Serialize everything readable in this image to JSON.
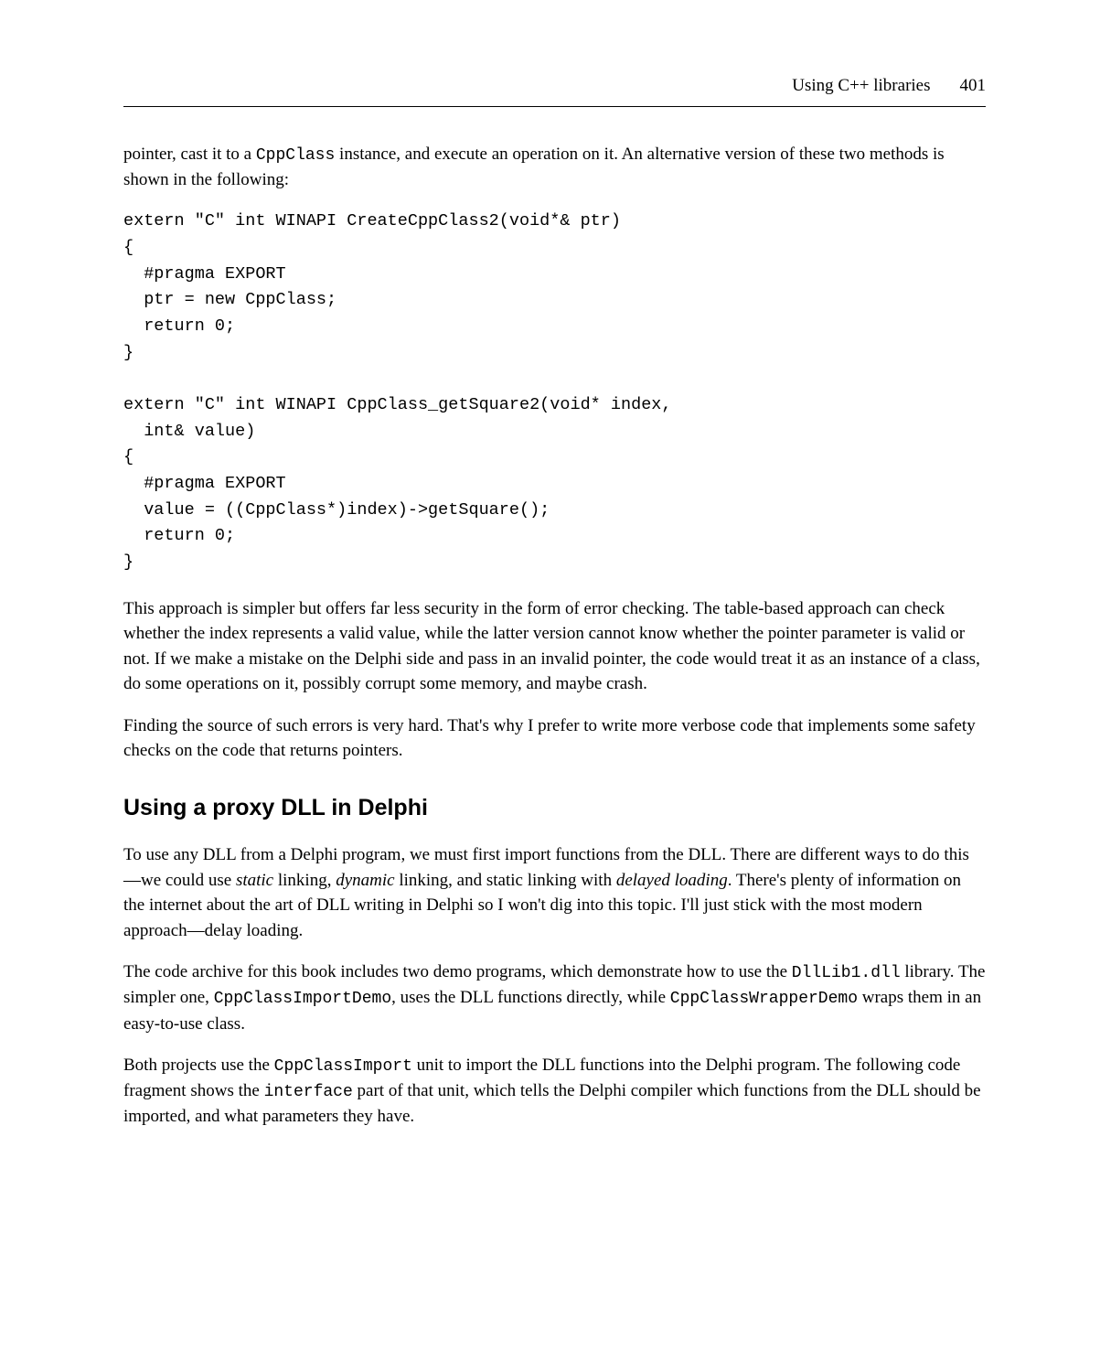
{
  "header": {
    "title": "Using C++ libraries",
    "page": "401"
  },
  "intro_prefix": "pointer, cast it to a ",
  "intro_code": "CppClass",
  "intro_suffix": " instance, and execute an operation on it. An alternative version of these two methods is shown in the following:",
  "code1": "extern \"C\" int WINAPI CreateCppClass2(void*& ptr)\n{\n  #pragma EXPORT\n  ptr = new CppClass;\n  return 0;\n}\n\nextern \"C\" int WINAPI CppClass_getSquare2(void* index,\n  int& value)\n{\n  #pragma EXPORT\n  value = ((CppClass*)index)->getSquare();\n  return 0;\n}",
  "para2": "This approach is simpler but offers far less security in the form of error checking. The table-based approach can check whether the index represents a valid value, while the latter version cannot know whether the pointer parameter is valid or not. If we make a mistake on the Delphi side and pass in an invalid pointer, the code would treat it as an instance of a class, do some operations on it, possibly corrupt some memory, and maybe crash.",
  "para3": "Finding the source of such errors is very hard. That's why I prefer to write more verbose code that implements some safety checks on the code that returns pointers.",
  "h2": "Using a proxy DLL in Delphi",
  "p4": {
    "s1": "To use any DLL from a Delphi program, we must first import functions from the DLL. There are different ways to do this—we could use ",
    "em1": "static",
    "s2": " linking, ",
    "em2": "dynamic",
    "s3": " linking, and static linking with ",
    "em3": "delayed loading",
    "s4": ". There's plenty of information on the internet about the art of DLL writing in Delphi so I won't dig into this topic. I'll just stick with the most modern approach—delay loading."
  },
  "p5": {
    "s1": "The code archive for this book includes two demo programs, which demonstrate how to use the ",
    "c1": "DllLib1.dll",
    "s2": " library. The simpler one, ",
    "c2": "CppClassImportDemo",
    "s3": ", uses the DLL functions directly, while ",
    "c3": "CppClassWrapperDemo",
    "s4": " wraps them in an easy-to-use class."
  },
  "p6": {
    "s1": "Both projects use the ",
    "c1": "CppClassImport",
    "s2": " unit to import the DLL functions into the Delphi program. The following code fragment shows the ",
    "c2": "interface",
    "s3": " part of that unit, which tells the Delphi compiler which functions from the DLL should be imported, and what parameters they have."
  }
}
